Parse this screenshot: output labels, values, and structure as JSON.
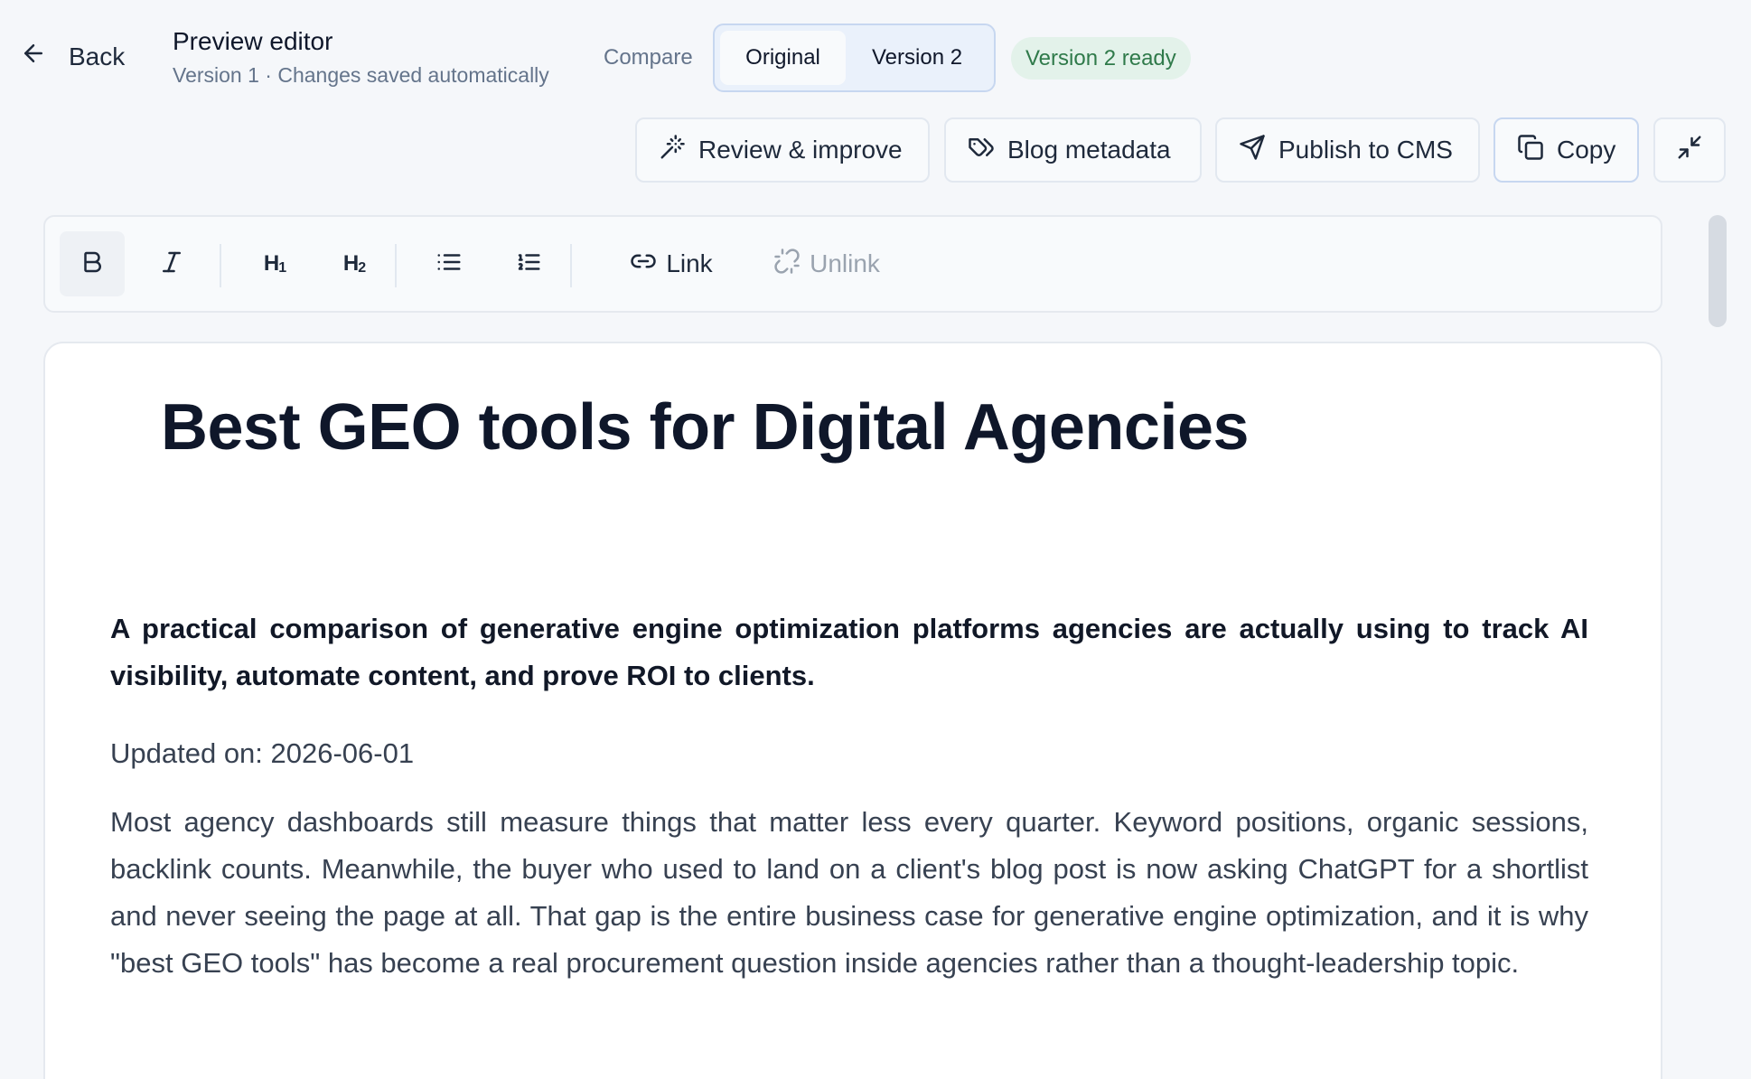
{
  "header": {
    "back_label": "Back",
    "title": "Preview editor",
    "subtitle": "Version 1 · Changes saved automatically",
    "compare_label": "Compare",
    "versions": {
      "original": "Original",
      "v2": "Version 2"
    },
    "status_badge": "Version 2 ready"
  },
  "actions": {
    "review": "Review & improve",
    "metadata": "Blog metadata",
    "publish": "Publish to CMS",
    "copy": "Copy"
  },
  "toolbar": {
    "link": "Link",
    "unlink": "Unlink"
  },
  "icons": {
    "back": "arrow-left-icon",
    "review": "magic-wand-icon",
    "metadata": "tag-icon",
    "publish": "send-icon",
    "copy": "copy-icon",
    "collapse": "minimize-icon",
    "bold": "bold-icon",
    "italic": "italic-icon",
    "h1": "heading-1-icon",
    "h2": "heading-2-icon",
    "bullet_list": "bullet-list-icon",
    "ordered_list": "ordered-list-icon",
    "link": "link-icon",
    "unlink": "unlink-icon"
  },
  "document": {
    "title": "Best GEO tools for Digital Agencies",
    "subtitle": "A practical comparison of generative engine optimization platforms agencies are actually using to track AI visibility, automate content, and prove ROI to clients.",
    "updated": "Updated on: 2026-06-01",
    "paragraph": "Most agency dashboards still measure things that matter less every quarter. Keyword positions, organic sessions, backlink counts. Meanwhile, the buyer who used to land on a client's blog post is now asking ChatGPT for a shortlist and never seeing the page at all. That gap is the entire business case for generative engine optimization, and it is why \"best GEO tools\" has become a real procurement question inside agencies rather than a thought-leadership topic."
  },
  "colors": {
    "background": "#f5f7fa",
    "accent_border": "#c7d7f0",
    "badge_bg": "#e3f2ea",
    "badge_text": "#2f7a4a"
  }
}
